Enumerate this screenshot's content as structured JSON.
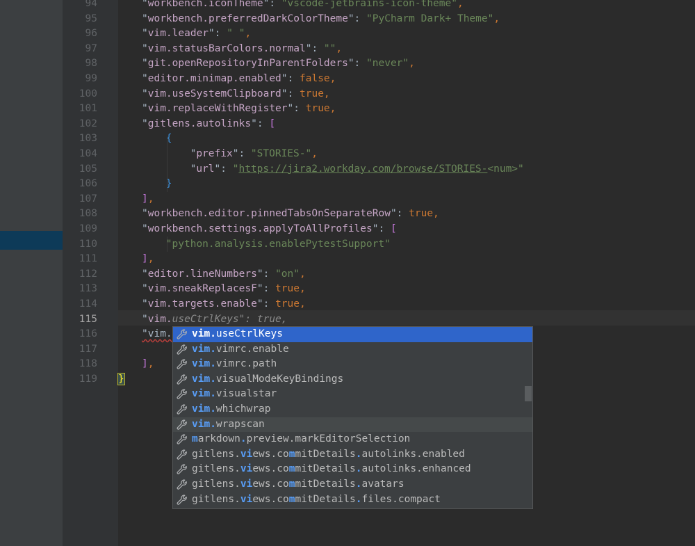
{
  "editor": {
    "lines": [
      {
        "n": "94",
        "parts": [
          [
            "p",
            "\""
          ],
          [
            "k",
            "workbench.iconTheme"
          ],
          [
            "p",
            "\": "
          ],
          [
            "s",
            "\"vscode-jetbrains-icon-theme\""
          ],
          [
            "b",
            ","
          ]
        ]
      },
      {
        "n": "95",
        "parts": [
          [
            "p",
            "\""
          ],
          [
            "k",
            "workbench.preferredDarkColorTheme"
          ],
          [
            "p",
            "\": "
          ],
          [
            "s",
            "\"PyCharm Dark+ Theme\""
          ],
          [
            "b",
            ","
          ]
        ]
      },
      {
        "n": "96",
        "parts": [
          [
            "p",
            "\""
          ],
          [
            "k",
            "vim.leader"
          ],
          [
            "p",
            "\": "
          ],
          [
            "s",
            "\" \""
          ],
          [
            "b",
            ","
          ]
        ]
      },
      {
        "n": "97",
        "parts": [
          [
            "p",
            "\""
          ],
          [
            "k",
            "vim.statusBarColors.normal"
          ],
          [
            "p",
            "\": "
          ],
          [
            "s",
            "\"\""
          ],
          [
            "b",
            ","
          ]
        ]
      },
      {
        "n": "98",
        "parts": [
          [
            "p",
            "\""
          ],
          [
            "k",
            "git.openRepositoryInParentFolders"
          ],
          [
            "p",
            "\": "
          ],
          [
            "s",
            "\"never\""
          ],
          [
            "b",
            ","
          ]
        ]
      },
      {
        "n": "99",
        "parts": [
          [
            "p",
            "\""
          ],
          [
            "k",
            "editor.minimap.enabled"
          ],
          [
            "p",
            "\": "
          ],
          [
            "b",
            "false,"
          ]
        ]
      },
      {
        "n": "100",
        "parts": [
          [
            "p",
            "\""
          ],
          [
            "k",
            "vim.useSystemClipboard"
          ],
          [
            "p",
            "\": "
          ],
          [
            "b",
            "true,"
          ]
        ]
      },
      {
        "n": "101",
        "parts": [
          [
            "p",
            "\""
          ],
          [
            "k",
            "vim.replaceWithRegister"
          ],
          [
            "p",
            "\": "
          ],
          [
            "b",
            "true,"
          ]
        ]
      },
      {
        "n": "102",
        "parts": [
          [
            "p",
            "\""
          ],
          [
            "k",
            "gitlens.autolinks"
          ],
          [
            "p",
            "\": "
          ],
          [
            "brk1",
            "["
          ]
        ]
      },
      {
        "n": "103",
        "indent": 1,
        "parts": [
          [
            "brk2",
            "{"
          ]
        ]
      },
      {
        "n": "104",
        "indent": 2,
        "parts": [
          [
            "p",
            "\""
          ],
          [
            "k",
            "prefix"
          ],
          [
            "p",
            "\": "
          ],
          [
            "s",
            "\"STORIES-\""
          ],
          [
            "b",
            ","
          ]
        ]
      },
      {
        "n": "105",
        "indent": 2,
        "parts": [
          [
            "p",
            "\""
          ],
          [
            "k",
            "url"
          ],
          [
            "p",
            "\": "
          ],
          [
            "s",
            "\""
          ],
          [
            "link",
            "https://jira2.workday.com/browse/STORIES-"
          ],
          [
            "s",
            "<num>\""
          ]
        ]
      },
      {
        "n": "106",
        "indent": 1,
        "parts": [
          [
            "brk2",
            "}"
          ]
        ]
      },
      {
        "n": "107",
        "parts": [
          [
            "brk1",
            "]"
          ],
          [
            "b",
            ","
          ]
        ]
      },
      {
        "n": "108",
        "parts": [
          [
            "p",
            "\""
          ],
          [
            "k",
            "workbench.editor.pinnedTabsOnSeparateRow"
          ],
          [
            "p",
            "\": "
          ],
          [
            "b",
            "true,"
          ]
        ]
      },
      {
        "n": "109",
        "parts": [
          [
            "p",
            "\""
          ],
          [
            "k",
            "workbench.settings.applyToAllProfiles"
          ],
          [
            "p",
            "\": "
          ],
          [
            "brk1",
            "["
          ]
        ]
      },
      {
        "n": "110",
        "indent": 1,
        "parts": [
          [
            "s",
            "\"python.analysis.enablePytestSupport\""
          ]
        ]
      },
      {
        "n": "111",
        "parts": [
          [
            "brk1",
            "]"
          ],
          [
            "b",
            ","
          ]
        ]
      },
      {
        "n": "112",
        "parts": [
          [
            "p",
            "\""
          ],
          [
            "k",
            "editor.lineNumbers"
          ],
          [
            "p",
            "\": "
          ],
          [
            "s",
            "\"on\""
          ],
          [
            "b",
            ","
          ]
        ]
      },
      {
        "n": "113",
        "parts": [
          [
            "p",
            "\""
          ],
          [
            "k",
            "vim.sneakReplacesF"
          ],
          [
            "p",
            "\": "
          ],
          [
            "b",
            "true,"
          ]
        ]
      },
      {
        "n": "114",
        "parts": [
          [
            "p",
            "\""
          ],
          [
            "k",
            "vim.targets.enable"
          ],
          [
            "p",
            "\": "
          ],
          [
            "b",
            "true,"
          ]
        ]
      },
      {
        "n": "115",
        "current": true,
        "parts": [
          [
            "p",
            "\""
          ],
          [
            "k",
            "vim."
          ],
          [
            "ghost",
            "useCtrlKeys\": true,"
          ]
        ]
      },
      {
        "n": "116",
        "parts": [
          [
            "err",
            "\"vim."
          ]
        ]
      },
      {
        "n": "117",
        "parts": []
      },
      {
        "n": "118",
        "parts": [
          [
            "brk1",
            "]"
          ],
          [
            "b",
            ","
          ]
        ]
      },
      {
        "n": "119",
        "outer": true,
        "parts": [
          [
            "brace",
            "}"
          ]
        ]
      }
    ]
  },
  "completion": {
    "items": [
      {
        "match": "vim.",
        "rest": "useCtrlKeys",
        "selected": true
      },
      {
        "match": "vim.",
        "rest": "vimrc.enable"
      },
      {
        "match": "vim.",
        "rest": "vimrc.path"
      },
      {
        "match": "vim.",
        "rest": "visualModeKeyBindings"
      },
      {
        "match": "vim.",
        "rest": "visualstar"
      },
      {
        "match": "vim.",
        "rest": "whichwrap"
      },
      {
        "match": "vim.",
        "rest": "wrapscan",
        "alt": true
      },
      {
        "segments": [
          [
            "m",
            "m"
          ],
          [
            "",
            "arkdown"
          ],
          [
            "m",
            "."
          ],
          [
            "",
            "preview.markEditorSelection"
          ]
        ]
      },
      {
        "segments": [
          [
            "",
            "gitlens."
          ],
          [
            "m",
            "vi"
          ],
          [
            "",
            "ews.co"
          ],
          [
            "m",
            "m"
          ],
          [
            "",
            "mitDetails"
          ],
          [
            "m",
            "."
          ],
          [
            "",
            "autolinks.enabled"
          ]
        ]
      },
      {
        "segments": [
          [
            "",
            "gitlens."
          ],
          [
            "m",
            "vi"
          ],
          [
            "",
            "ews.co"
          ],
          [
            "m",
            "m"
          ],
          [
            "",
            "mitDetails"
          ],
          [
            "m",
            "."
          ],
          [
            "",
            "autolinks.enhanced"
          ]
        ]
      },
      {
        "segments": [
          [
            "",
            "gitlens."
          ],
          [
            "m",
            "vi"
          ],
          [
            "",
            "ews.co"
          ],
          [
            "m",
            "m"
          ],
          [
            "",
            "mitDetails"
          ],
          [
            "m",
            "."
          ],
          [
            "",
            "avatars"
          ]
        ]
      },
      {
        "segments": [
          [
            "",
            "gitlens."
          ],
          [
            "m",
            "vi"
          ],
          [
            "",
            "ews.co"
          ],
          [
            "m",
            "m"
          ],
          [
            "",
            "mitDetails"
          ],
          [
            "m",
            "."
          ],
          [
            "",
            "files.compact"
          ]
        ]
      }
    ],
    "icon": "wrench-icon"
  }
}
